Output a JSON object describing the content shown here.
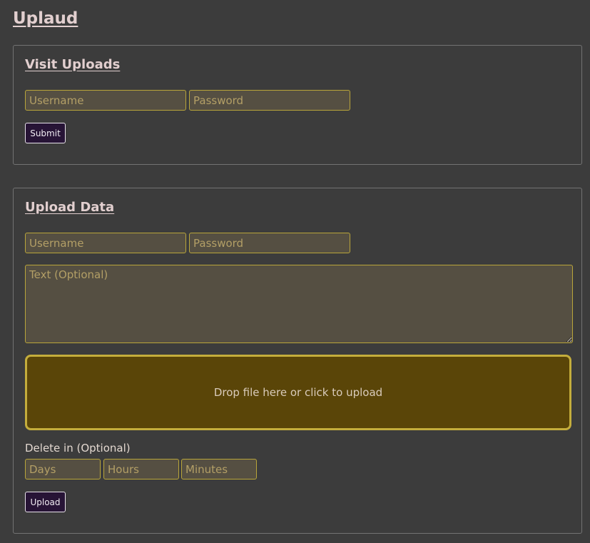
{
  "app": {
    "title": "Uplaud"
  },
  "visit_panel": {
    "title": "Visit Uploads",
    "username_placeholder": "Username",
    "password_placeholder": "Password",
    "submit_label": "Submit"
  },
  "upload_panel": {
    "title": "Upload Data",
    "username_placeholder": "Username",
    "password_placeholder": "Password",
    "text_placeholder": "Text (Optional)",
    "dropzone_text": "Drop file here or click to upload",
    "delete_label": "Delete in (Optional)",
    "days_placeholder": "Days",
    "hours_placeholder": "Hours",
    "minutes_placeholder": "Minutes",
    "upload_label": "Upload"
  },
  "colors": {
    "background": "#3c3c3c",
    "field_border": "#b9a53a",
    "dropzone_fill": "#5a4508",
    "button_fill": "#271436"
  }
}
